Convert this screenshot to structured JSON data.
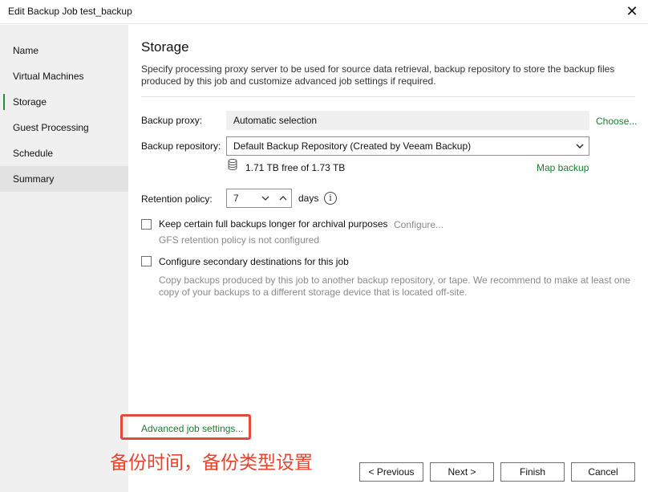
{
  "window": {
    "title": "Edit Backup Job test_backup"
  },
  "sidebar": {
    "items": [
      {
        "label": "Name"
      },
      {
        "label": "Virtual Machines"
      },
      {
        "label": "Storage"
      },
      {
        "label": "Guest Processing"
      },
      {
        "label": "Schedule"
      },
      {
        "label": "Summary"
      }
    ]
  },
  "page": {
    "heading": "Storage",
    "description": "Specify processing proxy server to be used for source data retrieval, backup repository to store the backup files produced by this job and customize advanced job settings if required."
  },
  "proxy": {
    "label": "Backup proxy:",
    "value": "Automatic selection",
    "choose": "Choose..."
  },
  "repository": {
    "label": "Backup repository:",
    "value": "Default Backup Repository (Created by Veeam Backup)",
    "free": "1.71 TB free of 1.73 TB",
    "map": "Map backup"
  },
  "retention": {
    "label": "Retention policy:",
    "value": "7",
    "unit": "days"
  },
  "gfs": {
    "label": "Keep certain full backups longer for archival purposes",
    "configure": "Configure...",
    "status": "GFS retention policy is not configured",
    "checked": false
  },
  "secondary": {
    "label": "Configure secondary destinations for this job",
    "hint": "Copy backups produced by this job to another backup repository, or tape. We recommend to make at least one copy of your backups to a different storage device that is located off-site.",
    "checked": false
  },
  "advanced": {
    "label": "Advanced job settings..."
  },
  "annotation": {
    "text": "备份时间，备份类型设置"
  },
  "buttons": {
    "previous": "< Previous",
    "next": "Next >",
    "finish": "Finish",
    "cancel": "Cancel"
  },
  "colors": {
    "accent": "#2c8a3e",
    "link": "#1e7b34",
    "annotation": "#e8432f"
  }
}
